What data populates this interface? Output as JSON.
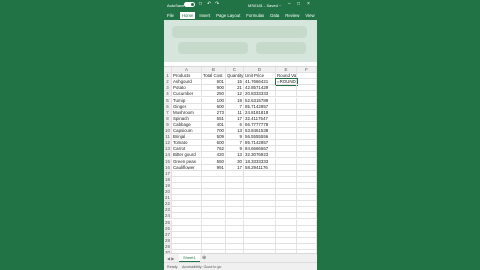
{
  "titlebar": {
    "autosave": "AutoSave",
    "filename": "MS0181 - Saved ~"
  },
  "ribbon_tabs": [
    "File",
    "Home",
    "Insert",
    "Page Layout",
    "Formulas",
    "Data",
    "Review",
    "View"
  ],
  "active_tab": "Home",
  "columns": [
    "",
    "A",
    "B",
    "C",
    "D",
    "E",
    "F"
  ],
  "headers": {
    "a": "Products",
    "b": "Total Cost",
    "c": "Quantity",
    "d": "Unit Price",
    "e": "Round Value"
  },
  "rows": [
    {
      "a": "Ashgourd",
      "b": "601",
      "c": "15",
      "d": "41.7666421",
      "e": "=ROUND(D2"
    },
    {
      "a": "Potato",
      "b": "900",
      "c": "21",
      "d": "42.8571429",
      "e": ""
    },
    {
      "a": "Cucumber",
      "b": "250",
      "c": "12",
      "d": "20.8333333",
      "e": ""
    },
    {
      "a": "Turnip",
      "b": "100",
      "c": "19",
      "d": "52.6315789",
      "e": ""
    },
    {
      "a": "Ginger",
      "b": "600",
      "c": "7",
      "d": "85.7142857",
      "e": ""
    },
    {
      "a": "Mushroom",
      "b": "273",
      "c": "11",
      "d": "24.8181818",
      "e": ""
    },
    {
      "a": "Spinach",
      "b": "551",
      "c": "17",
      "d": "32.4117647",
      "e": ""
    },
    {
      "a": "Cabbage",
      "b": "401",
      "c": "6",
      "d": "66.7777778",
      "e": ""
    },
    {
      "a": "Capsicum",
      "b": "700",
      "c": "13",
      "d": "53.8461538",
      "e": ""
    },
    {
      "a": "Brinjal",
      "b": "509",
      "c": "9",
      "d": "56.5555556",
      "e": ""
    },
    {
      "a": "Tomato",
      "b": "600",
      "c": "7",
      "d": "85.7142857",
      "e": ""
    },
    {
      "a": "Carrot",
      "b": "762",
      "c": "9",
      "d": "84.6666667",
      "e": ""
    },
    {
      "a": "Bitter gourd",
      "b": "420",
      "c": "13",
      "d": "32.3076923",
      "e": ""
    },
    {
      "a": "Green peas",
      "b": "550",
      "c": "30",
      "d": "18.3333333",
      "e": ""
    },
    {
      "a": "Cauliflower",
      "b": "991",
      "c": "17",
      "d": "58.2941176",
      "e": ""
    }
  ],
  "row_numbers": [
    "1",
    "2",
    "3",
    "4",
    "5",
    "6",
    "7",
    "8",
    "9",
    "10",
    "11",
    "12",
    "13",
    "14",
    "15",
    "16",
    "17",
    "18",
    "19",
    "20",
    "21",
    "22",
    "23",
    "24",
    "25",
    "26",
    "27",
    "28",
    "29",
    "30"
  ],
  "sheet_tab": "Sheet1",
  "status": {
    "ready": "Ready",
    "accessibility": "Accessibility: Good to go"
  },
  "colors": {
    "accent": "#217346"
  }
}
